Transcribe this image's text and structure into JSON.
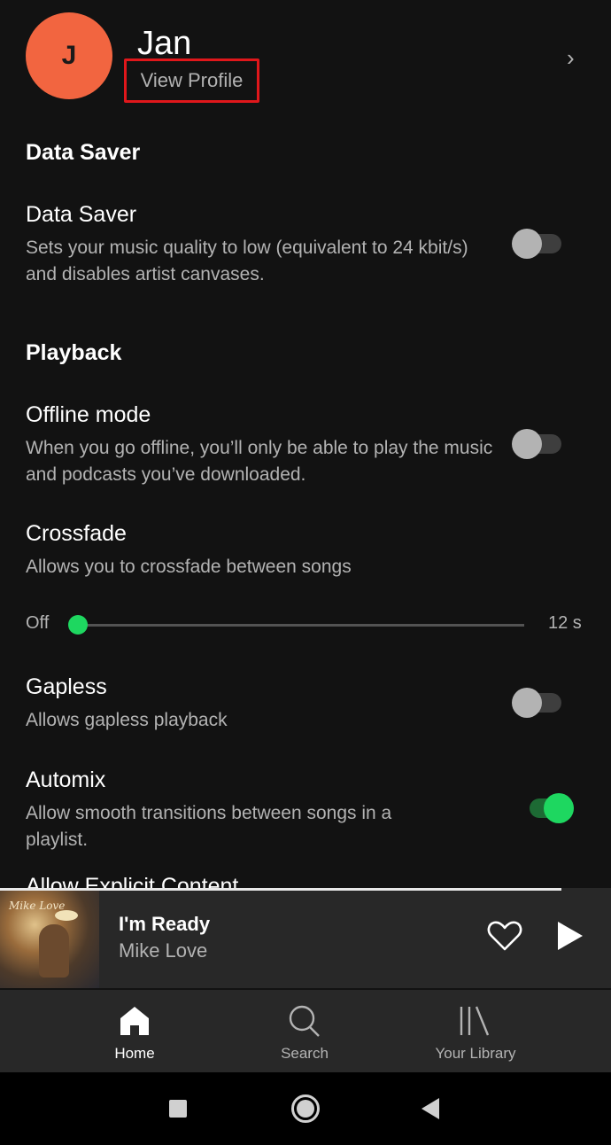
{
  "profile": {
    "avatar_initial": "J",
    "name": "Jan",
    "view_profile_label": "View Profile",
    "chevron": "›"
  },
  "sections": {
    "data_saver_header": "Data Saver",
    "playback_header": "Playback"
  },
  "settings": {
    "data_saver": {
      "title": "Data Saver",
      "description": "Sets your music quality to low (equivalent to 24 kbit/s) and disables artist canvases.",
      "enabled": false
    },
    "offline_mode": {
      "title": "Offline mode",
      "description": "When you go offline, you’ll only be able to play the music and podcasts you’ve downloaded.",
      "enabled": false
    },
    "crossfade": {
      "title": "Crossfade",
      "description": "Allows you to crossfade between songs",
      "min_label": "Off",
      "max_label": "12 s",
      "value_fraction": 0
    },
    "gapless": {
      "title": "Gapless",
      "description": "Allows gapless playback",
      "enabled": false
    },
    "automix": {
      "title": "Automix",
      "description": "Allow smooth transitions between songs in a playlist.",
      "enabled": true
    },
    "partial_next": "Allow Explicit Content"
  },
  "now_playing": {
    "title": "I'm Ready",
    "artist": "Mike Love",
    "album_art_text": "Mike Love",
    "heart_icon": "heart-outline-icon",
    "play_icon": "play-icon"
  },
  "nav": {
    "home": "Home",
    "search": "Search",
    "library": "Your Library"
  },
  "colors": {
    "accent_green": "#1ed760",
    "avatar_orange": "#f26540",
    "highlight_red": "#e0171b",
    "background": "#121212"
  }
}
